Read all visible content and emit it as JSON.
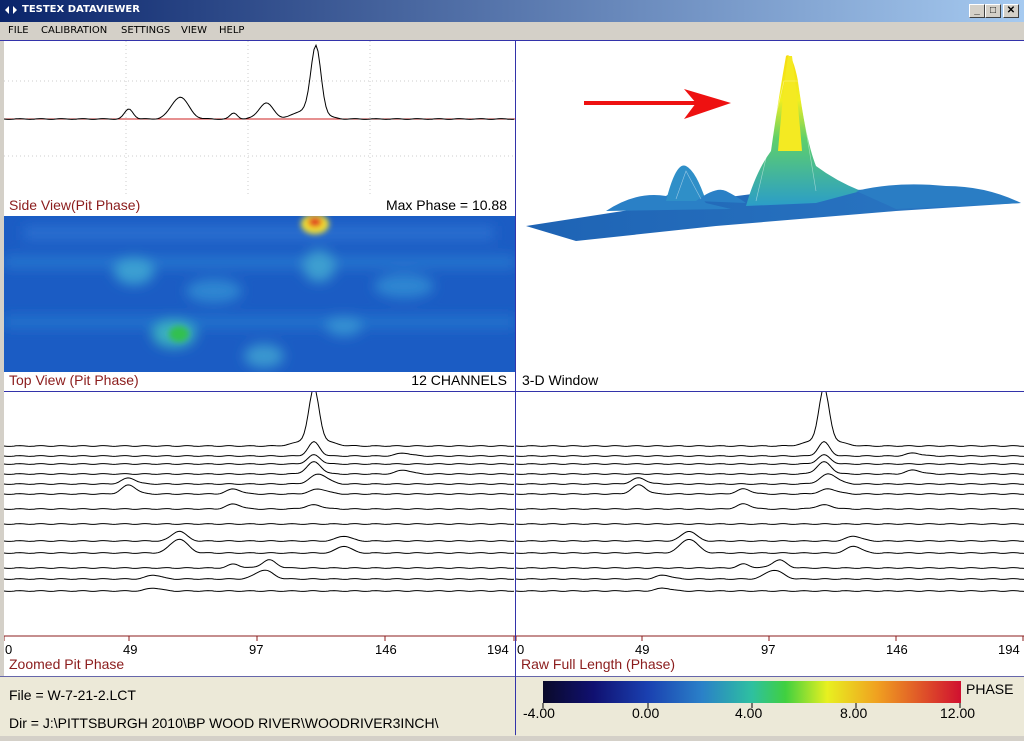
{
  "window": {
    "title": "TESTEX DATAVIEWER"
  },
  "menu": [
    "FILE",
    "CALIBRATION",
    "SETTINGS",
    "VIEW",
    "HELP"
  ],
  "side_view": {
    "caption": "Side View(Pit Phase)",
    "max_label": "Max Phase = 10.88"
  },
  "top_view": {
    "caption": "Top View (Pit Phase)",
    "channels_label": "12 CHANNELS"
  },
  "three_d": {
    "caption": "3-D Window"
  },
  "zoomed": {
    "caption": "Zoomed Pit Phase",
    "ticks": [
      "0",
      "49",
      "97",
      "146",
      "194"
    ]
  },
  "raw": {
    "caption": "Raw Full Length (Phase)",
    "ticks": [
      "0",
      "49",
      "97",
      "146",
      "194"
    ]
  },
  "status": {
    "file": "File = W-7-21-2.LCT",
    "dir": "Dir = J:\\PITTSBURGH 2010\\BP WOOD RIVER\\WOODRIVER3INCH\\"
  },
  "legend": {
    "title": "PHASE",
    "labels": [
      "-4.00",
      "0.00",
      "4.00",
      "8.00",
      "12.00"
    ]
  },
  "colors": {
    "caption": "#8b1c1c",
    "divider": "#3333aa",
    "baseline": "#cc2222"
  }
}
